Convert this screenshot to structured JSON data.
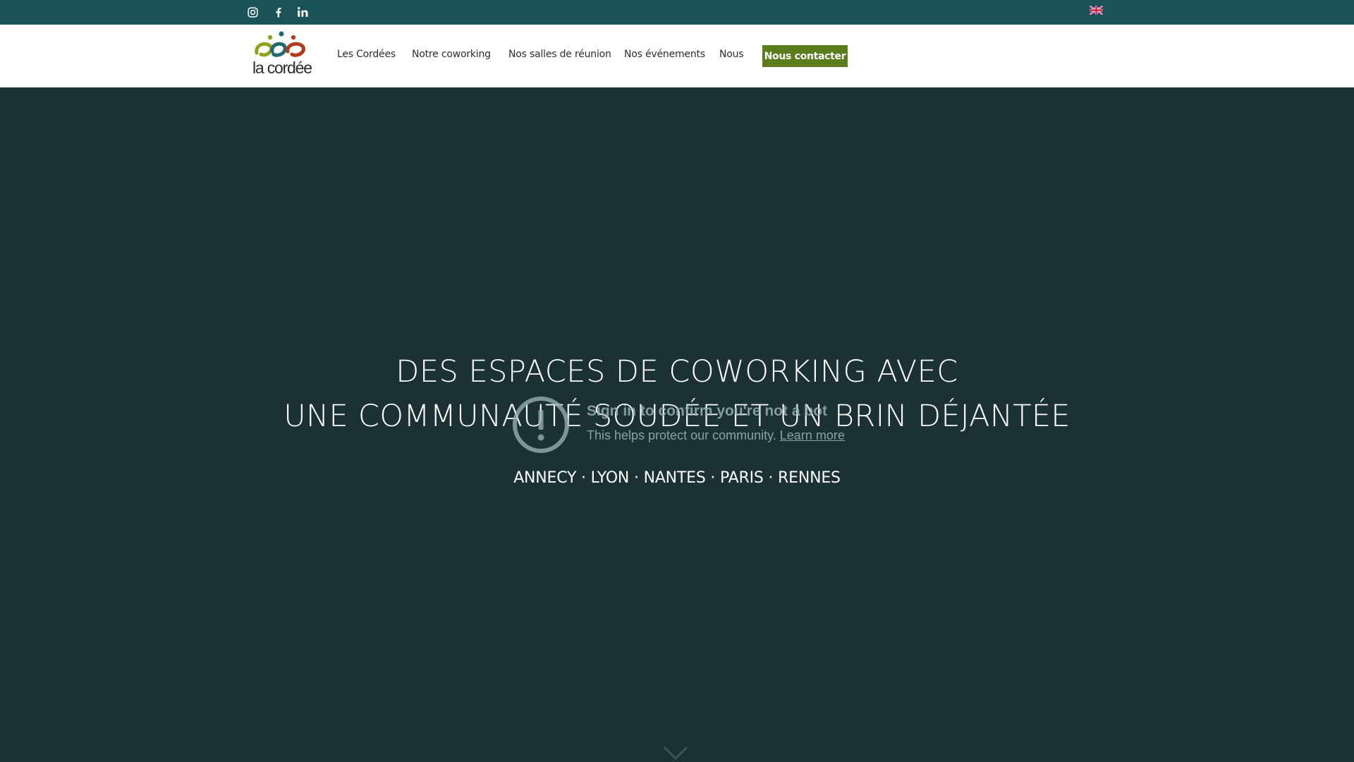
{
  "topbar": {
    "social": [
      {
        "icon": "instagram-icon"
      },
      {
        "icon": "facebook-icon"
      },
      {
        "icon": "linkedin-icon"
      }
    ],
    "language_flag": "uk-flag-icon"
  },
  "header": {
    "logo_text": "la cordée",
    "nav": [
      {
        "label": "Les Cordées"
      },
      {
        "label": "Notre coworking"
      },
      {
        "label": "Nos salles de réunion"
      },
      {
        "label": "Nos événements"
      },
      {
        "label": "Nous"
      }
    ],
    "cta_label": "Nous contacter"
  },
  "hero": {
    "line1": "DES ESPACES DE COWORKING AVEC",
    "line2": "UNE COMMUNAUTÉ SOUDÉE ET UN BRIN DÉJANTÉE",
    "cities": "ANNECY · LYON · NANTES · PARIS · RENNES"
  },
  "bot_check": {
    "title": "Sign in to confirm you're not a bot",
    "subtitle": "This helps protect our community.",
    "link": "Learn more"
  },
  "colors": {
    "topbar": "#1a5358",
    "hero_bg": "#1b3133",
    "cta_bg": "#5b7d1e",
    "logo_green": "#8ea31c",
    "logo_teal": "#1f6b6e",
    "logo_red": "#b23a1f"
  }
}
